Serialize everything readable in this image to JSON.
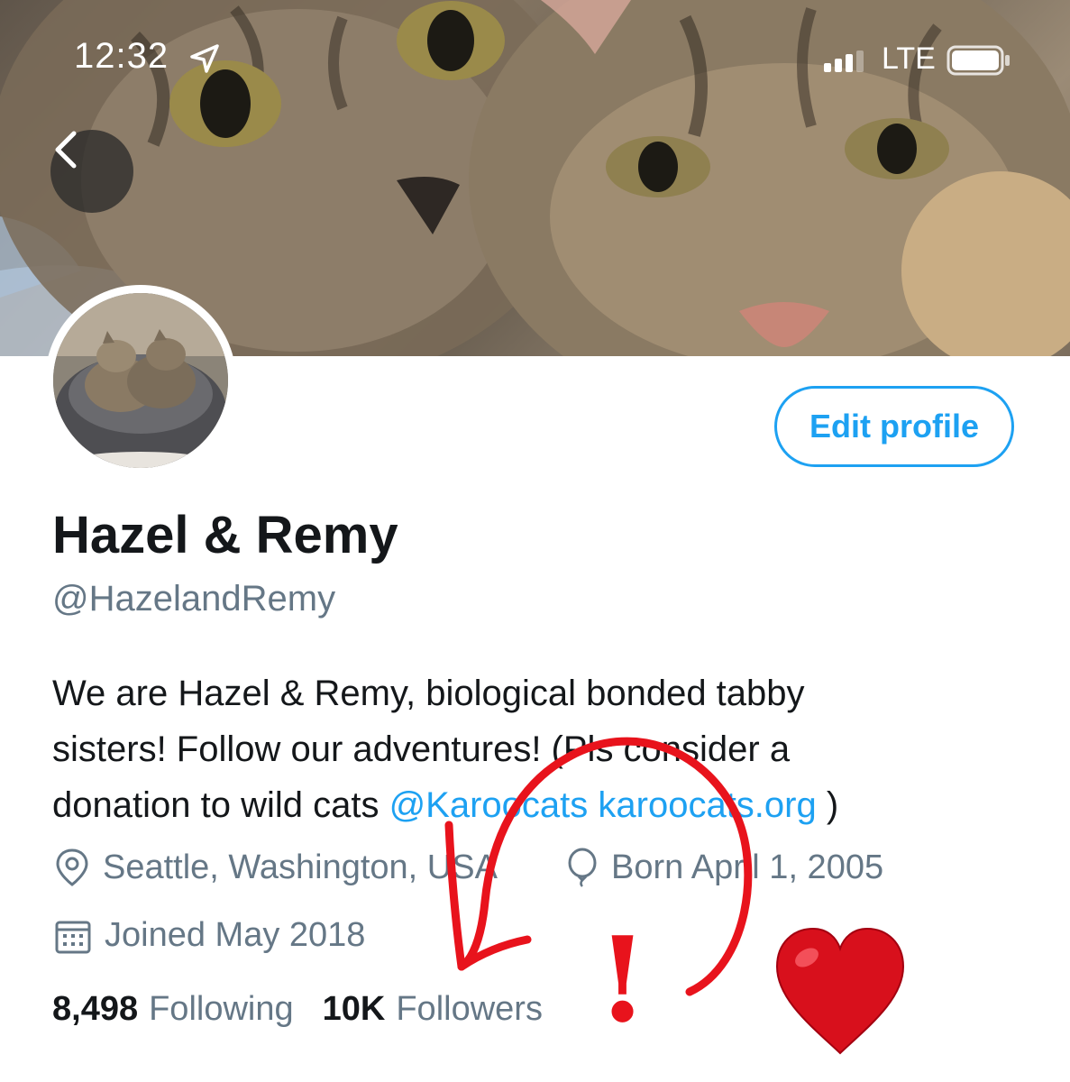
{
  "status_bar": {
    "time": "12:32",
    "network": "LTE"
  },
  "profile": {
    "display_name": "Hazel & Remy",
    "handle": "@HazelandRemy",
    "edit_label": "Edit profile",
    "bio": {
      "line1": "We are Hazel & Remy, biological bonded tabby",
      "line2": "sisters! Follow our adventures! (Pls consider a",
      "line3_prefix": "donation to wild cats ",
      "mention": "@Karoocats",
      "url": "karoocats.org",
      "line3_suffix": " )"
    },
    "location": "Seattle, Washington, USA",
    "birthday": "Born April 1, 2005",
    "joined": "Joined May 2018",
    "following_count": "8,498",
    "following_label": "Following",
    "followers_count": "10K",
    "followers_label": "Followers"
  },
  "annotation": {
    "exclamation": "!",
    "heart": "❤️"
  },
  "colors": {
    "accent": "#1da1f2",
    "muted": "#657786",
    "annotation_red": "#e8131c"
  },
  "icons": [
    "location-arrow-icon",
    "signal-icon",
    "battery-icon",
    "back-chevron-icon",
    "location-pin-icon",
    "balloon-icon",
    "calendar-icon"
  ]
}
